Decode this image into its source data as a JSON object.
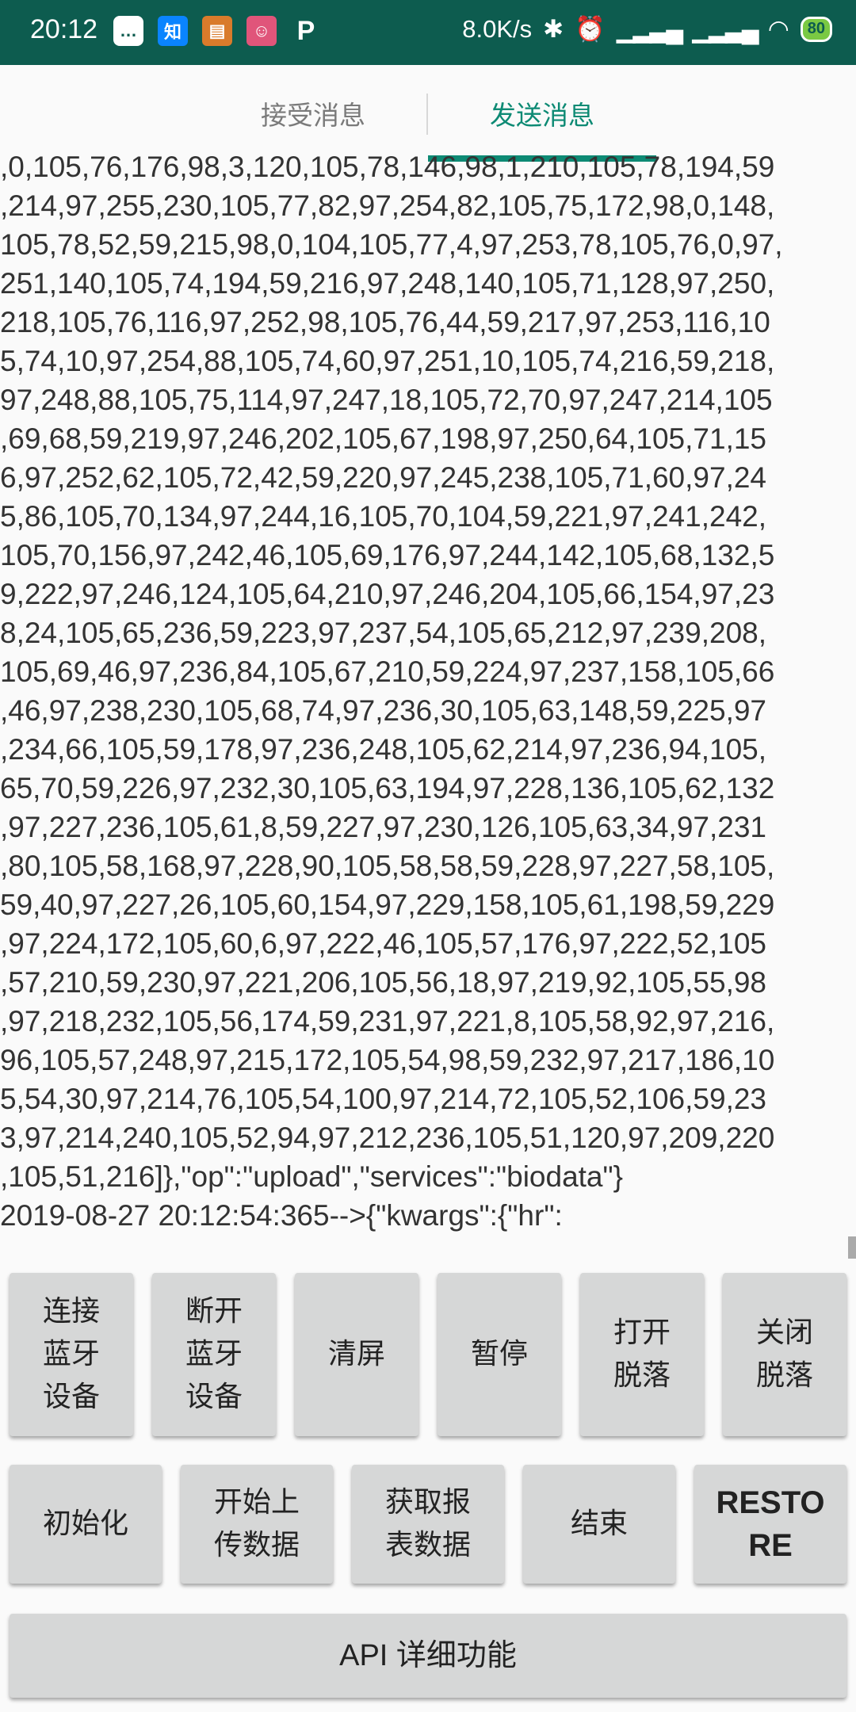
{
  "status_bar": {
    "time": "20:12",
    "network_speed": "8.0K/s",
    "battery_level": "80",
    "notifications": [
      {
        "icon": "message-icon",
        "label": "…",
        "color": "#ffffff"
      },
      {
        "icon": "zhihu-icon",
        "label": "知",
        "color": "#0a84ff"
      },
      {
        "icon": "app-icon",
        "label": "▤",
        "color": "#d97b2b"
      },
      {
        "icon": "pig-icon",
        "label": "☺",
        "color": "#e0557a"
      },
      {
        "icon": "p-icon",
        "label": "P",
        "color": "#0d5c4f"
      }
    ]
  },
  "tabs": {
    "receive": "接受消息",
    "send": "发送消息"
  },
  "log": {
    "lines": [
      ",0,105,76,176,98,3,120,105,78,146,98,1,210,105,78,194,59",
      ",214,97,255,230,105,77,82,97,254,82,105,75,172,98,0,148,",
      "105,78,52,59,215,98,0,104,105,77,4,97,253,78,105,76,0,97,",
      "251,140,105,74,194,59,216,97,248,140,105,71,128,97,250,",
      "218,105,76,116,97,252,98,105,76,44,59,217,97,253,116,10",
      "5,74,10,97,254,88,105,74,60,97,251,10,105,74,216,59,218,",
      "97,248,88,105,75,114,97,247,18,105,72,70,97,247,214,105",
      ",69,68,59,219,97,246,202,105,67,198,97,250,64,105,71,15",
      "6,97,252,62,105,72,42,59,220,97,245,238,105,71,60,97,24",
      "5,86,105,70,134,97,244,16,105,70,104,59,221,97,241,242,",
      "105,70,156,97,242,46,105,69,176,97,244,142,105,68,132,5",
      "9,222,97,246,124,105,64,210,97,246,204,105,66,154,97,23",
      "8,24,105,65,236,59,223,97,237,54,105,65,212,97,239,208,",
      "105,69,46,97,236,84,105,67,210,59,224,97,237,158,105,66",
      ",46,97,238,230,105,68,74,97,236,30,105,63,148,59,225,97",
      ",234,66,105,59,178,97,236,248,105,62,214,97,236,94,105,",
      "65,70,59,226,97,232,30,105,63,194,97,228,136,105,62,132",
      ",97,227,236,105,61,8,59,227,97,230,126,105,63,34,97,231",
      ",80,105,58,168,97,228,90,105,58,58,59,228,97,227,58,105,",
      "59,40,97,227,26,105,60,154,97,229,158,105,61,198,59,229",
      ",97,224,172,105,60,6,97,222,46,105,57,176,97,222,52,105",
      ",57,210,59,230,97,221,206,105,56,18,97,219,92,105,55,98",
      ",97,218,232,105,56,174,59,231,97,221,8,105,58,92,97,216,",
      "96,105,57,248,97,215,172,105,54,98,59,232,97,217,186,10",
      "5,54,30,97,214,76,105,54,100,97,214,72,105,52,106,59,23",
      "3,97,214,240,105,52,94,97,212,236,105,51,120,97,209,220",
      ",105,51,216]},\"op\":\"upload\",\"services\":\"biodata\"}",
      "2019-08-27 20:12:54:365-->{\"kwargs\":{\"hr\":"
    ]
  },
  "buttons": {
    "connect_bt": "连接\n蓝牙\n设备",
    "disconnect_bt": "断开\n蓝牙\n设备",
    "clear_screen": "清屏",
    "pause": "暂停",
    "open_drop": "打开\n脱落",
    "close_drop": "关闭\n脱落",
    "initialize": "初始化",
    "start_upload": "开始上\n传数据",
    "get_report": "获取报\n表数据",
    "end": "结束",
    "restore": "RESTO\nRE",
    "api_details": "API 详细功能"
  }
}
